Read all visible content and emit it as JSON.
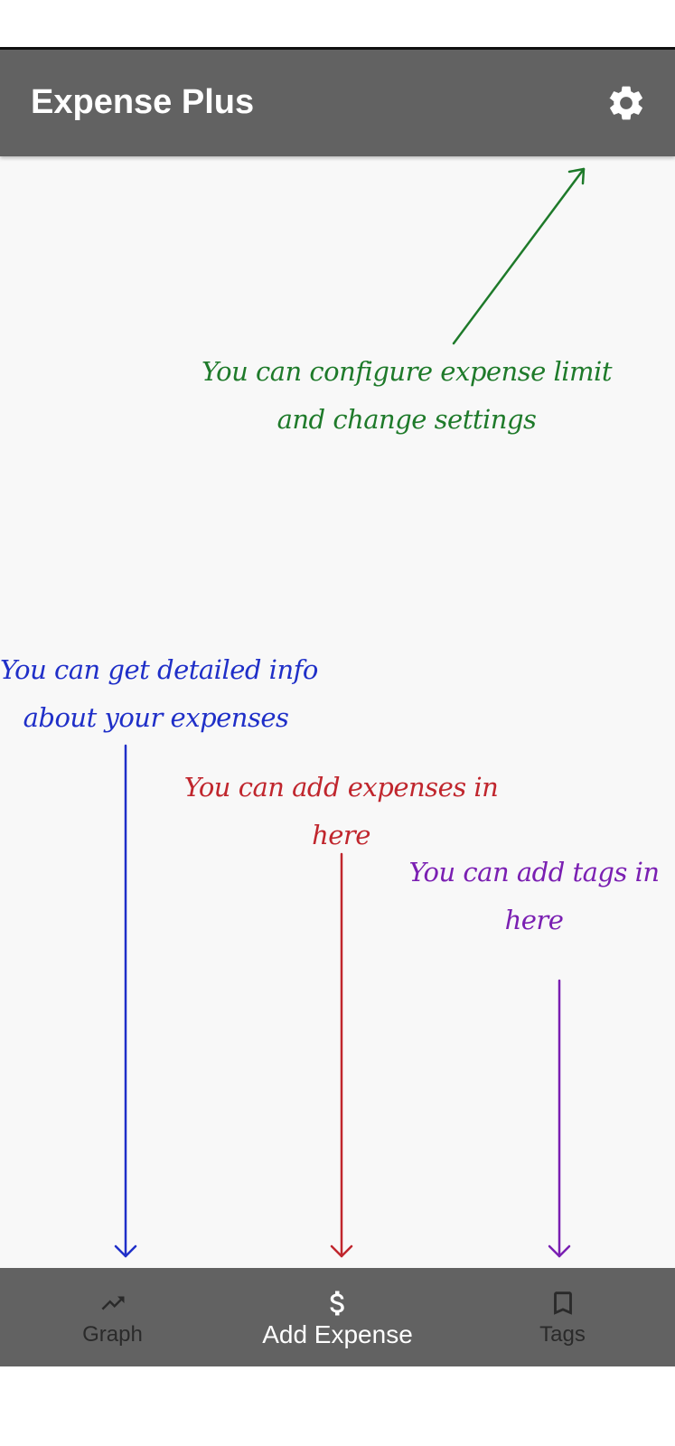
{
  "app": {
    "title": "Expense Plus",
    "settings_icon": "gear-icon"
  },
  "annotations": {
    "settings": {
      "line1": "You can configure expense limit",
      "line2": "and change settings",
      "color": "#1e7a2a"
    },
    "graph": {
      "line1": "You can get detailed info",
      "line2": "about your expenses",
      "color": "#1f2fc8"
    },
    "add_expense": {
      "line1": "You can add expenses in",
      "line2": "here",
      "color": "#c0262d"
    },
    "tags": {
      "line1": "You can add tags in",
      "line2": "here",
      "color": "#7a1fb2"
    }
  },
  "bottom_nav": {
    "items": [
      {
        "label": "Graph",
        "icon": "trending-up-icon",
        "active": false
      },
      {
        "label": "Add Expense",
        "icon": "dollar-icon",
        "active": true
      },
      {
        "label": "Tags",
        "icon": "bookmark-icon",
        "active": false
      }
    ]
  },
  "colors": {
    "app_bar": "#626262",
    "background": "#f8f8f8",
    "active_text": "#ffffff",
    "inactive_text": "#2a2a2a"
  }
}
